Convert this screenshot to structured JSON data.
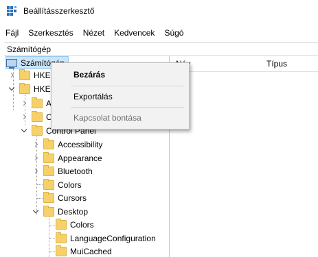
{
  "window": {
    "title": "Beállításszerkesztő"
  },
  "menu": [
    "Fájl",
    "Szerkesztés",
    "Nézet",
    "Kedvencek",
    "Súgó"
  ],
  "address": "Számítógép",
  "list_header": {
    "name": "Név",
    "type": "Típus"
  },
  "tree": {
    "root": "Számítógép",
    "hkcr_partial": "HKE",
    "hkcu_partial": "HKE",
    "child_a_partial": "A",
    "child_c_partial": "C",
    "control_panel": "Control Panel",
    "items": [
      "Accessibility",
      "Appearance",
      "Bluetooth",
      "Colors",
      "Cursors",
      "Desktop"
    ],
    "desktop_children": [
      "Colors",
      "LanguageConfiguration",
      "MuiCached"
    ]
  },
  "context_menu": {
    "collapse": "Bezárás",
    "export": "Exportálás",
    "disconnect": "Kapcsolat bontása"
  },
  "colors": {
    "selection": "#cce4f7",
    "folder": "#f6d16a",
    "disabled_text": "#6d6d6d"
  }
}
